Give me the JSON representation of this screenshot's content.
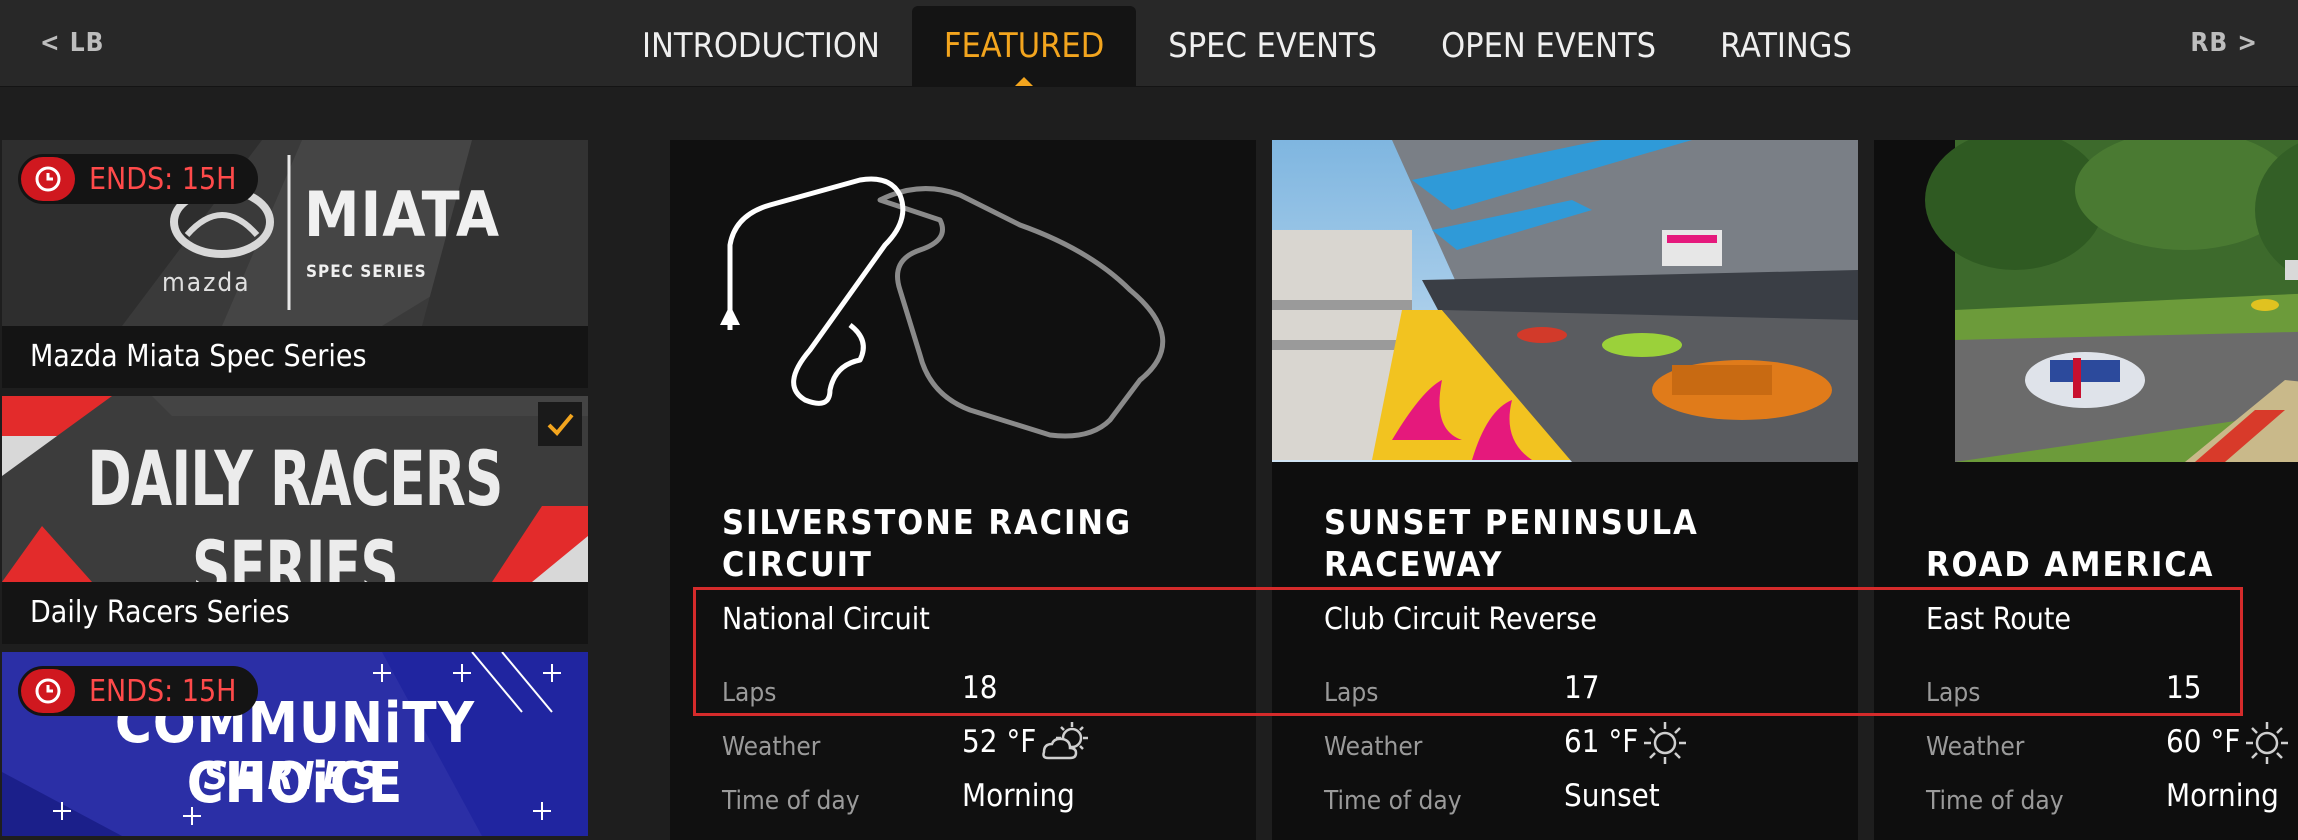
{
  "nav": {
    "left_bumper": "< LB",
    "right_bumper": "RB >",
    "tabs": [
      {
        "label": "INTRODUCTION",
        "active": false
      },
      {
        "label": "FEATURED",
        "active": true
      },
      {
        "label": "SPEC EVENTS",
        "active": false
      },
      {
        "label": "OPEN EVENTS",
        "active": false
      },
      {
        "label": "RATINGS",
        "active": false
      }
    ],
    "active_color": "#f3a51e"
  },
  "series": [
    {
      "label": "Mazda Miata Spec Series",
      "badge": "ENDS: 15H",
      "logo_title": "MIATA",
      "logo_subtitle": "SPEC SERIES",
      "logo_brand": "mazda"
    },
    {
      "label": "Daily Racers Series",
      "banner": "DAILY RACERS SERIES",
      "completed": true
    },
    {
      "label": "",
      "badge": "ENDS: 15H",
      "banner_line1": "COMMUNiTY CHOiCE",
      "banner_line2": "SERIES"
    }
  ],
  "events": [
    {
      "track_line1": "SILVERSTONE RACING",
      "track_line2": "CIRCUIT",
      "layout": "National Circuit",
      "laps_label": "Laps",
      "laps": "18",
      "weather_label": "Weather",
      "weather": "52 °F",
      "weather_icon": "partly-cloudy-icon",
      "time_label": "Time of day",
      "time": "Morning"
    },
    {
      "track_line1": "SUNSET PENINSULA",
      "track_line2": "RACEWAY",
      "layout": "Club Circuit Reverse",
      "laps_label": "Laps",
      "laps": "17",
      "weather_label": "Weather",
      "weather": "61 °F",
      "weather_icon": "sun-icon",
      "time_label": "Time of day",
      "time": "Sunset"
    },
    {
      "track_line1": "ROAD AMERICA",
      "layout": "East Route",
      "laps_label": "Laps",
      "laps": "15",
      "weather_label": "Weather",
      "weather": "60 °F",
      "weather_icon": "sun-icon",
      "time_label": "Time of day",
      "time": "Morning"
    }
  ],
  "colors": {
    "badge_red": "#d0181f",
    "badge_text": "#ff4a4a",
    "highlight": "#d52b2b",
    "community_blue": "#2b2fa6"
  }
}
